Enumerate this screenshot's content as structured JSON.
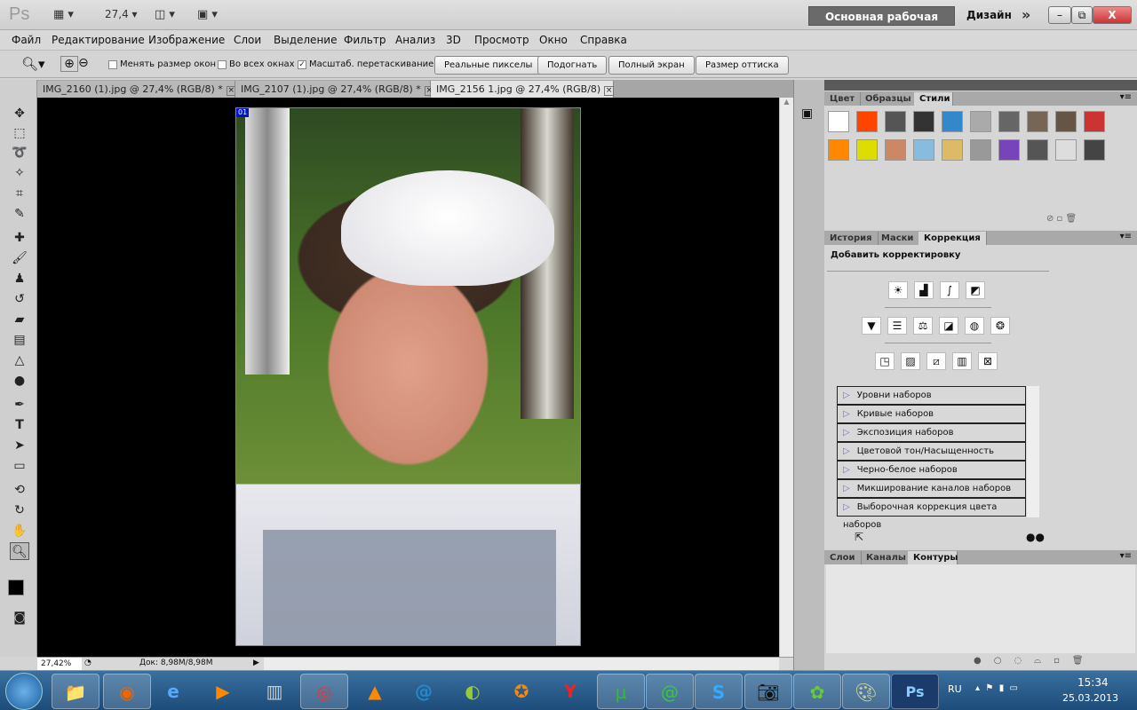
{
  "app": {
    "logo": "Ps",
    "zoom_value": "27,4",
    "workspace": "Основная рабочая среда",
    "design": "Дизайн"
  },
  "menu": [
    "Файл",
    "Редактирование",
    "Изображение",
    "Слои",
    "Выделение",
    "Фильтр",
    "Анализ",
    "3D",
    "Просмотр",
    "Окно",
    "Справка"
  ],
  "options": {
    "checkboxes": [
      {
        "label": "Менять размер окон",
        "checked": false
      },
      {
        "label": "Во всех окнах",
        "checked": false
      },
      {
        "label": "Масштаб. перетаскиванием",
        "checked": true
      }
    ],
    "buttons": [
      "Реальные пикселы",
      "Подогнать",
      "Полный экран",
      "Размер оттиска"
    ]
  },
  "documents": [
    {
      "title": "IMG_2160 (1).jpg @ 27,4% (RGB/8) *",
      "active": false
    },
    {
      "title": "IMG_2107 (1).jpg @ 27,4% (RGB/8) *",
      "active": false
    },
    {
      "title": "IMG_2156 1.jpg @ 27,4% (RGB/8)",
      "active": true
    }
  ],
  "canvas": {
    "badge": "01"
  },
  "status": {
    "zoom": "27,42%",
    "doc": "Док: 8,98M/8,98M"
  },
  "styles_panel": {
    "tabs": [
      "Цвет",
      "Образцы",
      "Стили"
    ],
    "active": "Стили"
  },
  "adjust_panel": {
    "tabs": [
      "История",
      "Маски",
      "Коррекция"
    ],
    "active": "Коррекция",
    "heading": "Добавить корректировку",
    "presets": [
      "Уровни наборов",
      "Кривые наборов",
      "Экспозиция наборов",
      "Цветовой тон/Насыщенность наборов",
      "Черно-белое наборов",
      "Микширование каналов наборов",
      "Выборочная коррекция цвета наборов"
    ]
  },
  "paths_panel": {
    "tabs": [
      "Слои",
      "Каналы",
      "Контуры"
    ],
    "active": "Контуры"
  },
  "taskbar": {
    "lang": "RU",
    "time": "15:34",
    "date": "25.03.2013"
  },
  "colors": {
    "accent_blue": "#0014c8",
    "taskbar": "#1d4c7a",
    "workspace_btn": "#6a6a6a"
  }
}
